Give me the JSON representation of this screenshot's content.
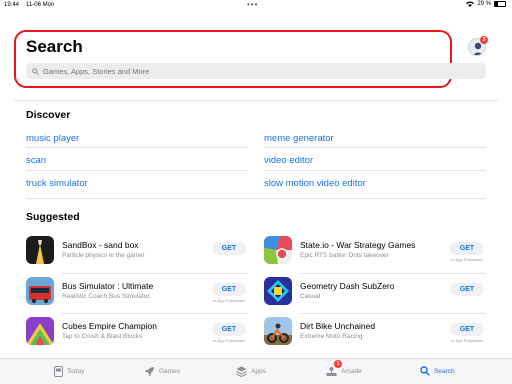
{
  "status_bar": {
    "time": "19:44",
    "date": "11-06 Mon",
    "battery": "29 %",
    "battery_level": 0.29
  },
  "header": {
    "title": "Search",
    "search_placeholder": "Games, Apps, Stories and More",
    "account_badge": "3"
  },
  "discover": {
    "title": "Discover",
    "links": [
      "music player",
      "meme generator",
      "scan",
      "video editor",
      "truck simulator",
      "slow motion video editor"
    ]
  },
  "suggested": {
    "title": "Suggested",
    "apps": [
      {
        "name": "SandBox - sand box",
        "subtitle": "Particle physics in the game!",
        "button": "GET",
        "note": ""
      },
      {
        "name": "State.io - War Strategy Games",
        "subtitle": "Epic RTS battle: Dots takeover",
        "button": "GET",
        "note": "In-App Purchases"
      },
      {
        "name": "Bus Simulator : Ultimate",
        "subtitle": "Realistic Coach Bus Simulator.",
        "button": "GET",
        "note": "In-App Purchases"
      },
      {
        "name": "Geometry Dash SubZero",
        "subtitle": "Casual",
        "button": "GET",
        "note": ""
      },
      {
        "name": "Cubes Empire Champion",
        "subtitle": "Tap to Crush & Blast Blocks",
        "button": "GET",
        "note": "In-App Purchases"
      },
      {
        "name": "Dirt Bike Unchained",
        "subtitle": "Extreme Moto Racing",
        "button": "GET",
        "note": "In-App Purchases"
      }
    ]
  },
  "tab_bar": {
    "tabs": [
      "Today",
      "Games",
      "Apps",
      "Arcade",
      "Search"
    ],
    "active": "Search",
    "arcade_badge": "1"
  },
  "colors": {
    "accent": "#1a73e8",
    "highlight_box": "#e8161b",
    "badge": "#ff3b30"
  }
}
